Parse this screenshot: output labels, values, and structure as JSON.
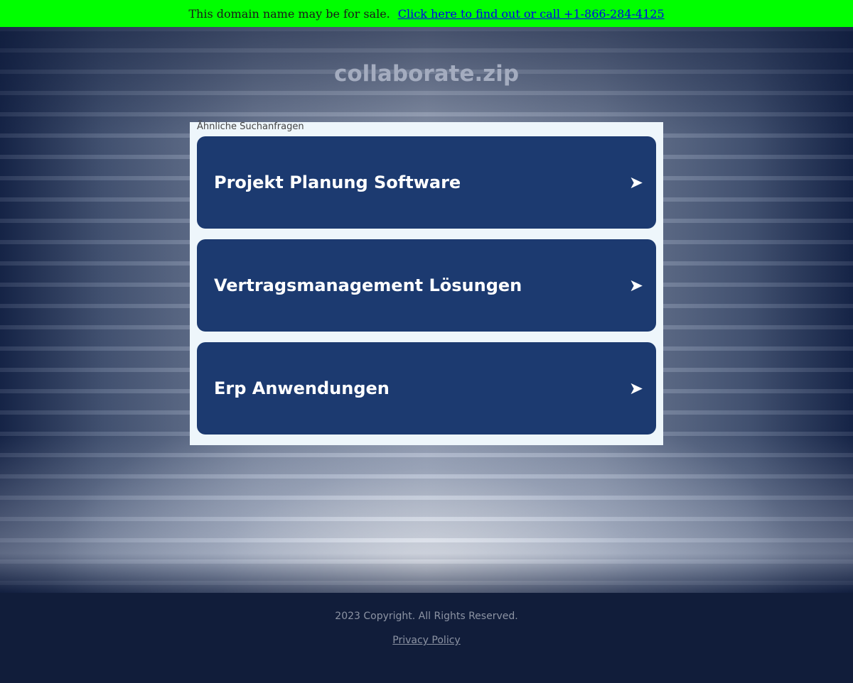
{
  "sale_bar": {
    "text": "This domain name may be for sale.",
    "link_text": "Click here to find out or call +1-866-284-4125",
    "background": "#00ff00"
  },
  "domain": "collaborate.zip",
  "related": {
    "caption": "Ähnliche Suchanfragen",
    "items": [
      {
        "label": "Projekt Planung Software",
        "arrow": "➤"
      },
      {
        "label": "Vertragsmanagement Lösungen",
        "arrow": "➤"
      },
      {
        "label": "Erp Anwendungen",
        "arrow": "➤"
      }
    ],
    "button_color": "#1c3a70"
  },
  "footer": {
    "copyright": "2023 Copyright. All Rights Reserved.",
    "privacy_label": "Privacy Policy"
  }
}
